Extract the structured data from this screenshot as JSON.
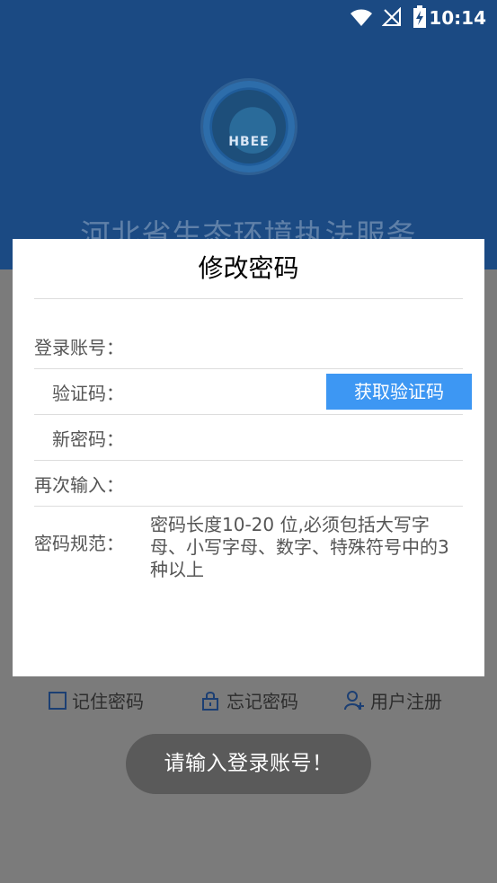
{
  "status_bar": {
    "time": "10:14",
    "icons": [
      "wifi-icon",
      "no-signal-icon",
      "battery-charging-icon"
    ]
  },
  "app": {
    "logo_text": "HBEE",
    "title": "河北省生态环境执法服务"
  },
  "modal": {
    "title": "修改密码",
    "fields": {
      "account_label": "登录账号：",
      "code_label": "验证码：",
      "new_password_label": "新密码：",
      "repeat_label": "再次输入："
    },
    "get_code_button": "获取验证码",
    "rules_label": "密码规范：",
    "rules_text": "密码长度10-20 位,必须包括大写字母、小写字母、数字、特殊符号中的3种以上"
  },
  "bottom_actions": {
    "remember": "记住密码",
    "forgot": "忘记密码",
    "register": "用户注册"
  },
  "toast": {
    "message": "请输入登录账号！"
  },
  "colors": {
    "header_bg": "#1b4a83",
    "overlay_bg": "#7b7b7b",
    "button_bg": "#3d97f3",
    "toast_bg": "#5a5a5a"
  }
}
